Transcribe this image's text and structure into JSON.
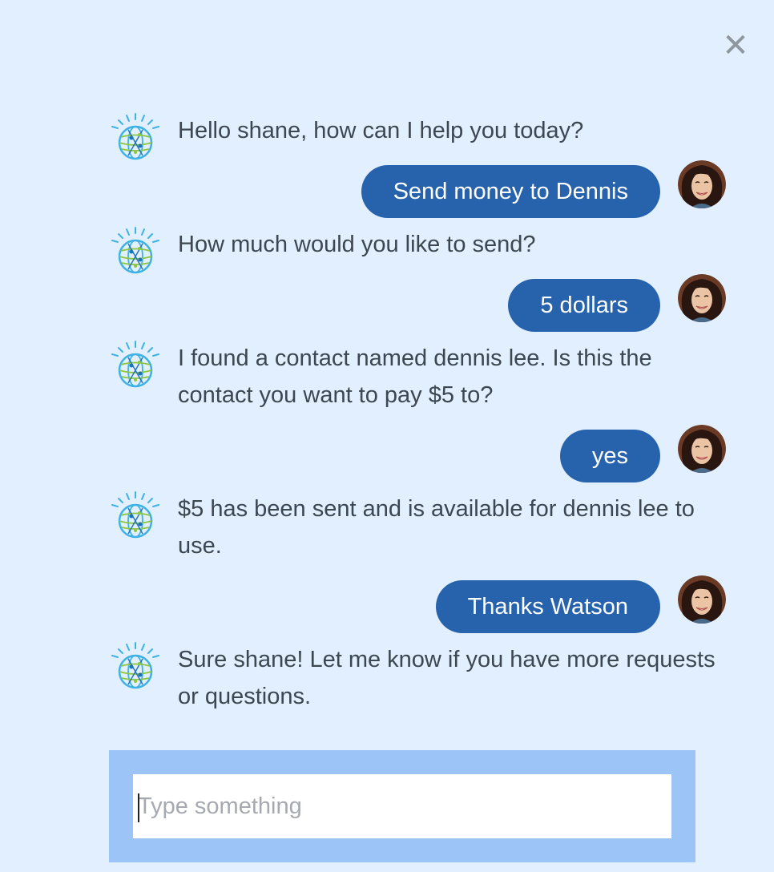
{
  "chat": {
    "close_icon": "close-icon",
    "messages": [
      {
        "sender": "bot",
        "text": "Hello shane, how can I help you today?"
      },
      {
        "sender": "user",
        "text": "Send money to Dennis"
      },
      {
        "sender": "bot",
        "text": "How much would you like to send?"
      },
      {
        "sender": "user",
        "text": "5 dollars"
      },
      {
        "sender": "bot",
        "text": "I found a contact named dennis lee. Is this the contact you want to pay $5 to?"
      },
      {
        "sender": "user",
        "text": "yes"
      },
      {
        "sender": "bot",
        "text": "$5 has been sent and is available for dennis lee to use."
      },
      {
        "sender": "user",
        "text": "Thanks Watson"
      },
      {
        "sender": "bot",
        "text": "Sure shane! Let me know if you have more requests or questions."
      }
    ],
    "icons": {
      "bot": "watson-globe-icon",
      "user": "user-avatar"
    }
  },
  "input": {
    "placeholder": "Type something",
    "value": ""
  },
  "colors": {
    "background": "#e1efff",
    "user_bubble": "#2763ad",
    "input_panel": "#9cc4f7"
  }
}
